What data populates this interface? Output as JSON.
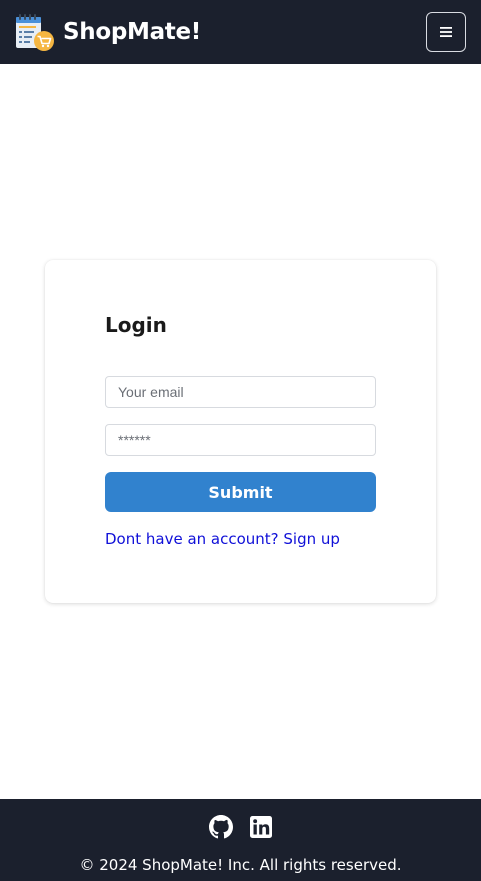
{
  "header": {
    "brand": "ShopMate!",
    "logo_icon": "shopping-list-cart-icon",
    "menu_icon": "hamburger-menu-icon"
  },
  "login": {
    "title": "Login",
    "email_placeholder": "Your email",
    "password_placeholder": "******",
    "submit_label": "Submit",
    "signup_link": "Dont have an account? Sign up"
  },
  "footer": {
    "social": [
      "github-icon",
      "linkedin-icon"
    ],
    "copyright": "© 2024 ShopMate! Inc. All rights reserved."
  },
  "colors": {
    "nav_bg": "#1b202d",
    "primary": "#3182ce",
    "link": "#1010d8"
  }
}
